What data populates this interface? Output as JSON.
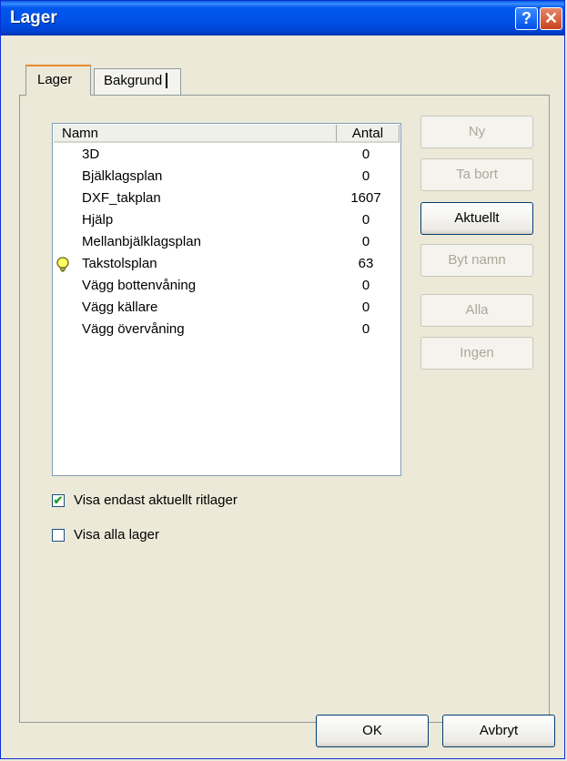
{
  "window": {
    "title": "Lager"
  },
  "tabs": [
    {
      "label": "Lager",
      "active": true
    },
    {
      "label": "Bakgrund",
      "active": false
    }
  ],
  "list": {
    "columns": [
      "Namn",
      "Antal"
    ],
    "rows": [
      {
        "name": "3D",
        "count": "0",
        "current": false
      },
      {
        "name": "Bjälklagsplan",
        "count": "0",
        "current": false
      },
      {
        "name": "DXF_takplan",
        "count": "1607",
        "current": false
      },
      {
        "name": "Hjälp",
        "count": "0",
        "current": false
      },
      {
        "name": "Mellanbjälklagsplan",
        "count": "0",
        "current": false
      },
      {
        "name": "Takstolsplan",
        "count": "63",
        "current": true
      },
      {
        "name": "Vägg bottenvåning",
        "count": "0",
        "current": false
      },
      {
        "name": "Vägg källare",
        "count": "0",
        "current": false
      },
      {
        "name": "Vägg övervåning",
        "count": "0",
        "current": false
      }
    ]
  },
  "buttons": {
    "new": "Ny",
    "delete": "Ta bort",
    "current": "Aktuellt",
    "rename": "Byt namn",
    "all": "Alla",
    "none": "Ingen",
    "ok": "OK",
    "cancel": "Avbryt"
  },
  "checkboxes": [
    {
      "label": "Visa endast aktuellt ritlager",
      "checked": true
    },
    {
      "label": "Visa alla lager",
      "checked": false
    }
  ]
}
